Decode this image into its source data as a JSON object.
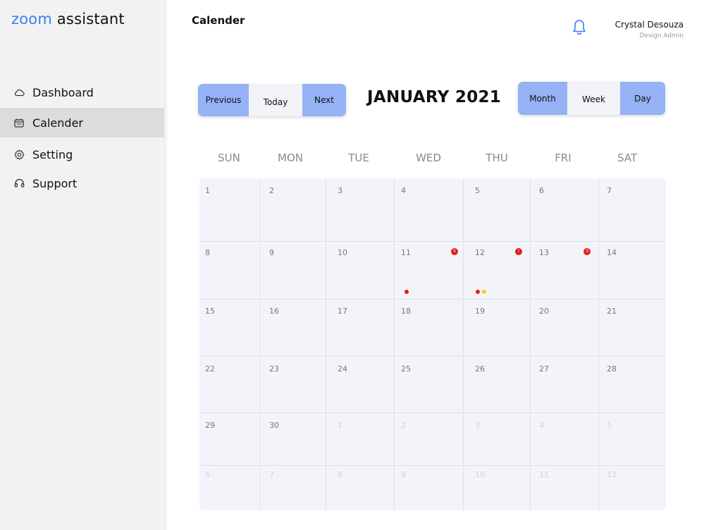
{
  "brand": {
    "part1": "zoom",
    "part2": " assistant"
  },
  "nav": [
    {
      "label": "Dashboard",
      "icon": "cloud-icon"
    },
    {
      "label": "Calender",
      "icon": "calendar-icon"
    },
    {
      "label": "Setting",
      "icon": "gear-icon"
    },
    {
      "label": "Support",
      "icon": "headset-icon"
    }
  ],
  "header": {
    "title": "Calender",
    "user_name": "Crystal Desouza",
    "user_role": "Design Admin"
  },
  "controls": {
    "previous": "Previous",
    "today": "Today",
    "next": "Next",
    "month": "Month",
    "week": "Week",
    "day": "Day"
  },
  "calendar": {
    "month_title": "JANUARY 2021",
    "weekdays": [
      "SUN",
      "MON",
      "TUE",
      "WED",
      "THU",
      "FRI",
      "SAT"
    ],
    "weeks": [
      [
        "1",
        "2",
        "3",
        "4",
        "5",
        "6",
        "7"
      ],
      [
        "8",
        "9",
        "10",
        "11",
        "12",
        "13",
        "14"
      ],
      [
        "15",
        "16",
        "17",
        "18",
        "19",
        "20",
        "21"
      ],
      [
        "22",
        "23",
        "24",
        "25",
        "26",
        "27",
        "28"
      ],
      [
        "29",
        "30",
        "1",
        "2",
        "3",
        "4",
        "5"
      ],
      [
        "6",
        "7",
        "8",
        "9",
        "10",
        "11",
        "12"
      ]
    ],
    "badges": {
      "11": "5",
      "12": "!",
      "13": "3"
    }
  },
  "colors": {
    "accent": "#94b2f4",
    "brand": "#3d7bf5",
    "event_red": "#e21c1c",
    "event_yellow": "#f2d21b"
  }
}
